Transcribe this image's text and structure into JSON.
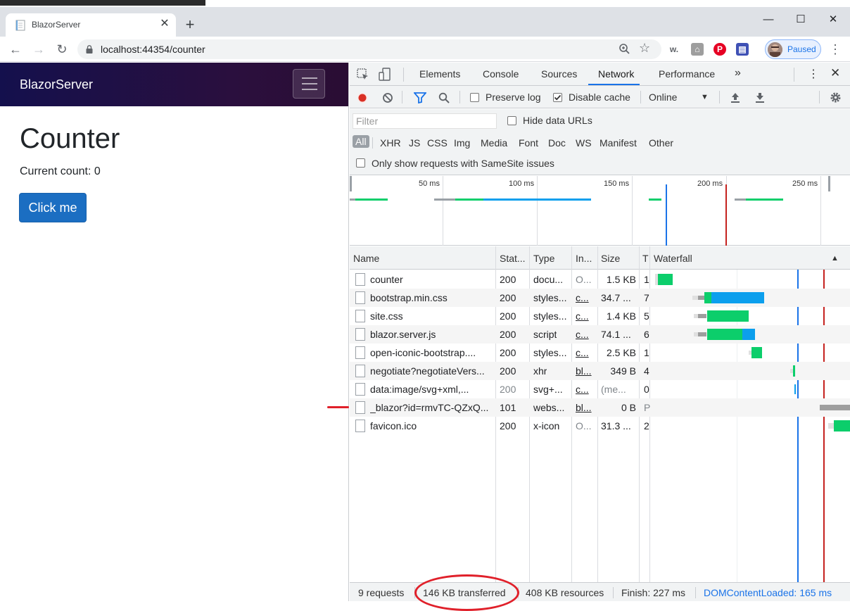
{
  "browser": {
    "tab_title": "BlazorServer",
    "tab_close": "✕",
    "new_tab": "+",
    "url": "localhost:44354/counter",
    "profile_label": "Paused",
    "window_controls": {
      "minimize": "—",
      "maximize": "☐",
      "close": "✕"
    },
    "extensions": [
      "w.",
      "pinterest-icon",
      "save-icon"
    ]
  },
  "app": {
    "brand": "BlazorServer",
    "heading": "Counter",
    "count_text": "Current count: 0",
    "button_label": "Click me",
    "colors": {
      "button": "#1b6ec2",
      "navbar_start": "#14104d",
      "navbar_end": "#2a0d33"
    }
  },
  "devtools": {
    "tabs": [
      "Elements",
      "Console",
      "Sources",
      "Network",
      "Performance"
    ],
    "active_tab": "Network",
    "more_tabs": "»",
    "toolbar": {
      "preserve_log": "Preserve log",
      "preserve_log_checked": false,
      "disable_cache": "Disable cache",
      "disable_cache_checked": true,
      "throttling": "Online"
    },
    "filter": {
      "placeholder": "Filter",
      "hide_data_urls": "Hide data URLs",
      "types": [
        "All",
        "XHR",
        "JS",
        "CSS",
        "Img",
        "Media",
        "Font",
        "Doc",
        "WS",
        "Manifest",
        "Other"
      ],
      "active_type": "All",
      "samesite": "Only show requests with SameSite issues"
    },
    "overview_ticks": [
      "50 ms",
      "100 ms",
      "150 ms",
      "200 ms",
      "250 ms"
    ],
    "columns": [
      "Name",
      "Stat...",
      "Type",
      "In...",
      "Size",
      "T",
      "Waterfall"
    ],
    "rows": [
      {
        "name": "counter",
        "status": "200",
        "type": "docu...",
        "initiator": "O...",
        "size": "1.5 KB",
        "time": "1",
        "status_dim": false,
        "init_ul": false
      },
      {
        "name": "bootstrap.min.css",
        "status": "200",
        "type": "styles...",
        "initiator": "c...",
        "size": "34.7 ...",
        "time": "7",
        "status_dim": false,
        "init_ul": true
      },
      {
        "name": "site.css",
        "status": "200",
        "type": "styles...",
        "initiator": "c...",
        "size": "1.4 KB",
        "time": "5",
        "status_dim": false,
        "init_ul": true
      },
      {
        "name": "blazor.server.js",
        "status": "200",
        "type": "script",
        "initiator": "c...",
        "size": "74.1 ...",
        "time": "6",
        "status_dim": false,
        "init_ul": true
      },
      {
        "name": "open-iconic-bootstrap....",
        "status": "200",
        "type": "styles...",
        "initiator": "c...",
        "size": "2.5 KB",
        "time": "1",
        "status_dim": false,
        "init_ul": true
      },
      {
        "name": "negotiate?negotiateVers...",
        "status": "200",
        "type": "xhr",
        "initiator": "bl...",
        "size": "349 B",
        "time": "4",
        "status_dim": false,
        "init_ul": true
      },
      {
        "name": "data:image/svg+xml,...",
        "status": "200",
        "type": "svg+...",
        "initiator": "c...",
        "size": "(me...",
        "time": "0",
        "status_dim": true,
        "init_ul": true
      },
      {
        "name": "_blazor?id=rmvTC-QZxQ...",
        "status": "101",
        "type": "webs...",
        "initiator": "bl...",
        "size": "0 B",
        "time": "P",
        "status_dim": false,
        "init_ul": true
      },
      {
        "name": "favicon.ico",
        "status": "200",
        "type": "x-icon",
        "initiator": "O...",
        "size": "31.3 ...",
        "time": "2",
        "status_dim": false,
        "init_ul": false
      }
    ],
    "status": {
      "requests": "9 requests",
      "transferred": "146 KB transferred",
      "resources": "408 KB resources",
      "finish": "Finish: 227 ms",
      "dcl": "DOMContentLoaded: 165 ms"
    }
  }
}
